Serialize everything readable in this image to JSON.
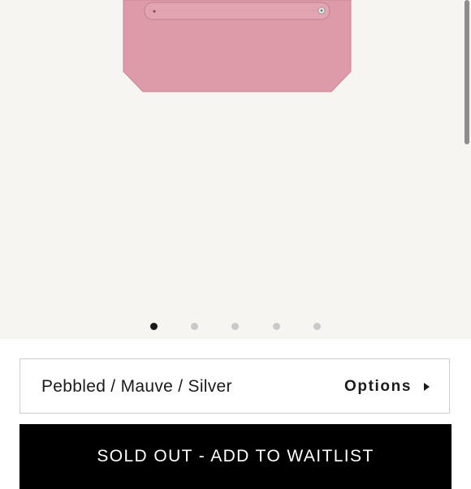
{
  "product": {
    "image_alt": "Pink pebbled leather pouch with strap",
    "variant_label": "Pebbled / Mauve / Silver",
    "options_label": "Options",
    "options_icon": "caret-right-icon",
    "cta_label": "SOLD OUT - ADD TO WAITLIST"
  },
  "gallery": {
    "slide_count": 5,
    "active_slide": 1
  },
  "colors": {
    "product": "#dd9aa8",
    "background": "#f7f5f2",
    "cta_background": "#000000"
  }
}
